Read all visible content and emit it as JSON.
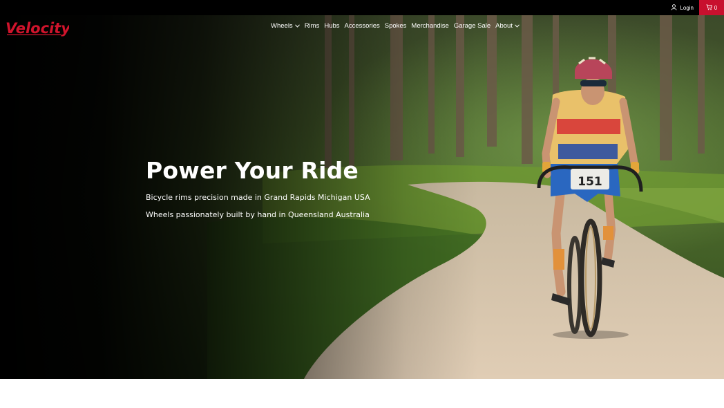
{
  "topbar": {
    "login_label": "Login",
    "cart_count": "0",
    "cart_color": "#c8102e",
    "login_icon": "user-icon",
    "cart_icon": "cart-icon"
  },
  "brand": {
    "logo_text": "Velocity",
    "logo_color": "#d0142c"
  },
  "nav": {
    "items": [
      {
        "label": "Wheels",
        "dropdown": true
      },
      {
        "label": "Rims",
        "dropdown": false
      },
      {
        "label": "Hubs",
        "dropdown": false
      },
      {
        "label": "Accessories",
        "dropdown": false
      },
      {
        "label": "Spokes",
        "dropdown": false
      },
      {
        "label": "Merchandise",
        "dropdown": false
      },
      {
        "label": "Garage Sale",
        "dropdown": false
      },
      {
        "label": "About",
        "dropdown": true
      }
    ]
  },
  "hero": {
    "title": "Power Your Ride",
    "line1": "Bicycle rims precision made in Grand Rapids Michigan USA",
    "line2": "Wheels passionately built by hand in Queensland Australia",
    "race_number": "151"
  }
}
